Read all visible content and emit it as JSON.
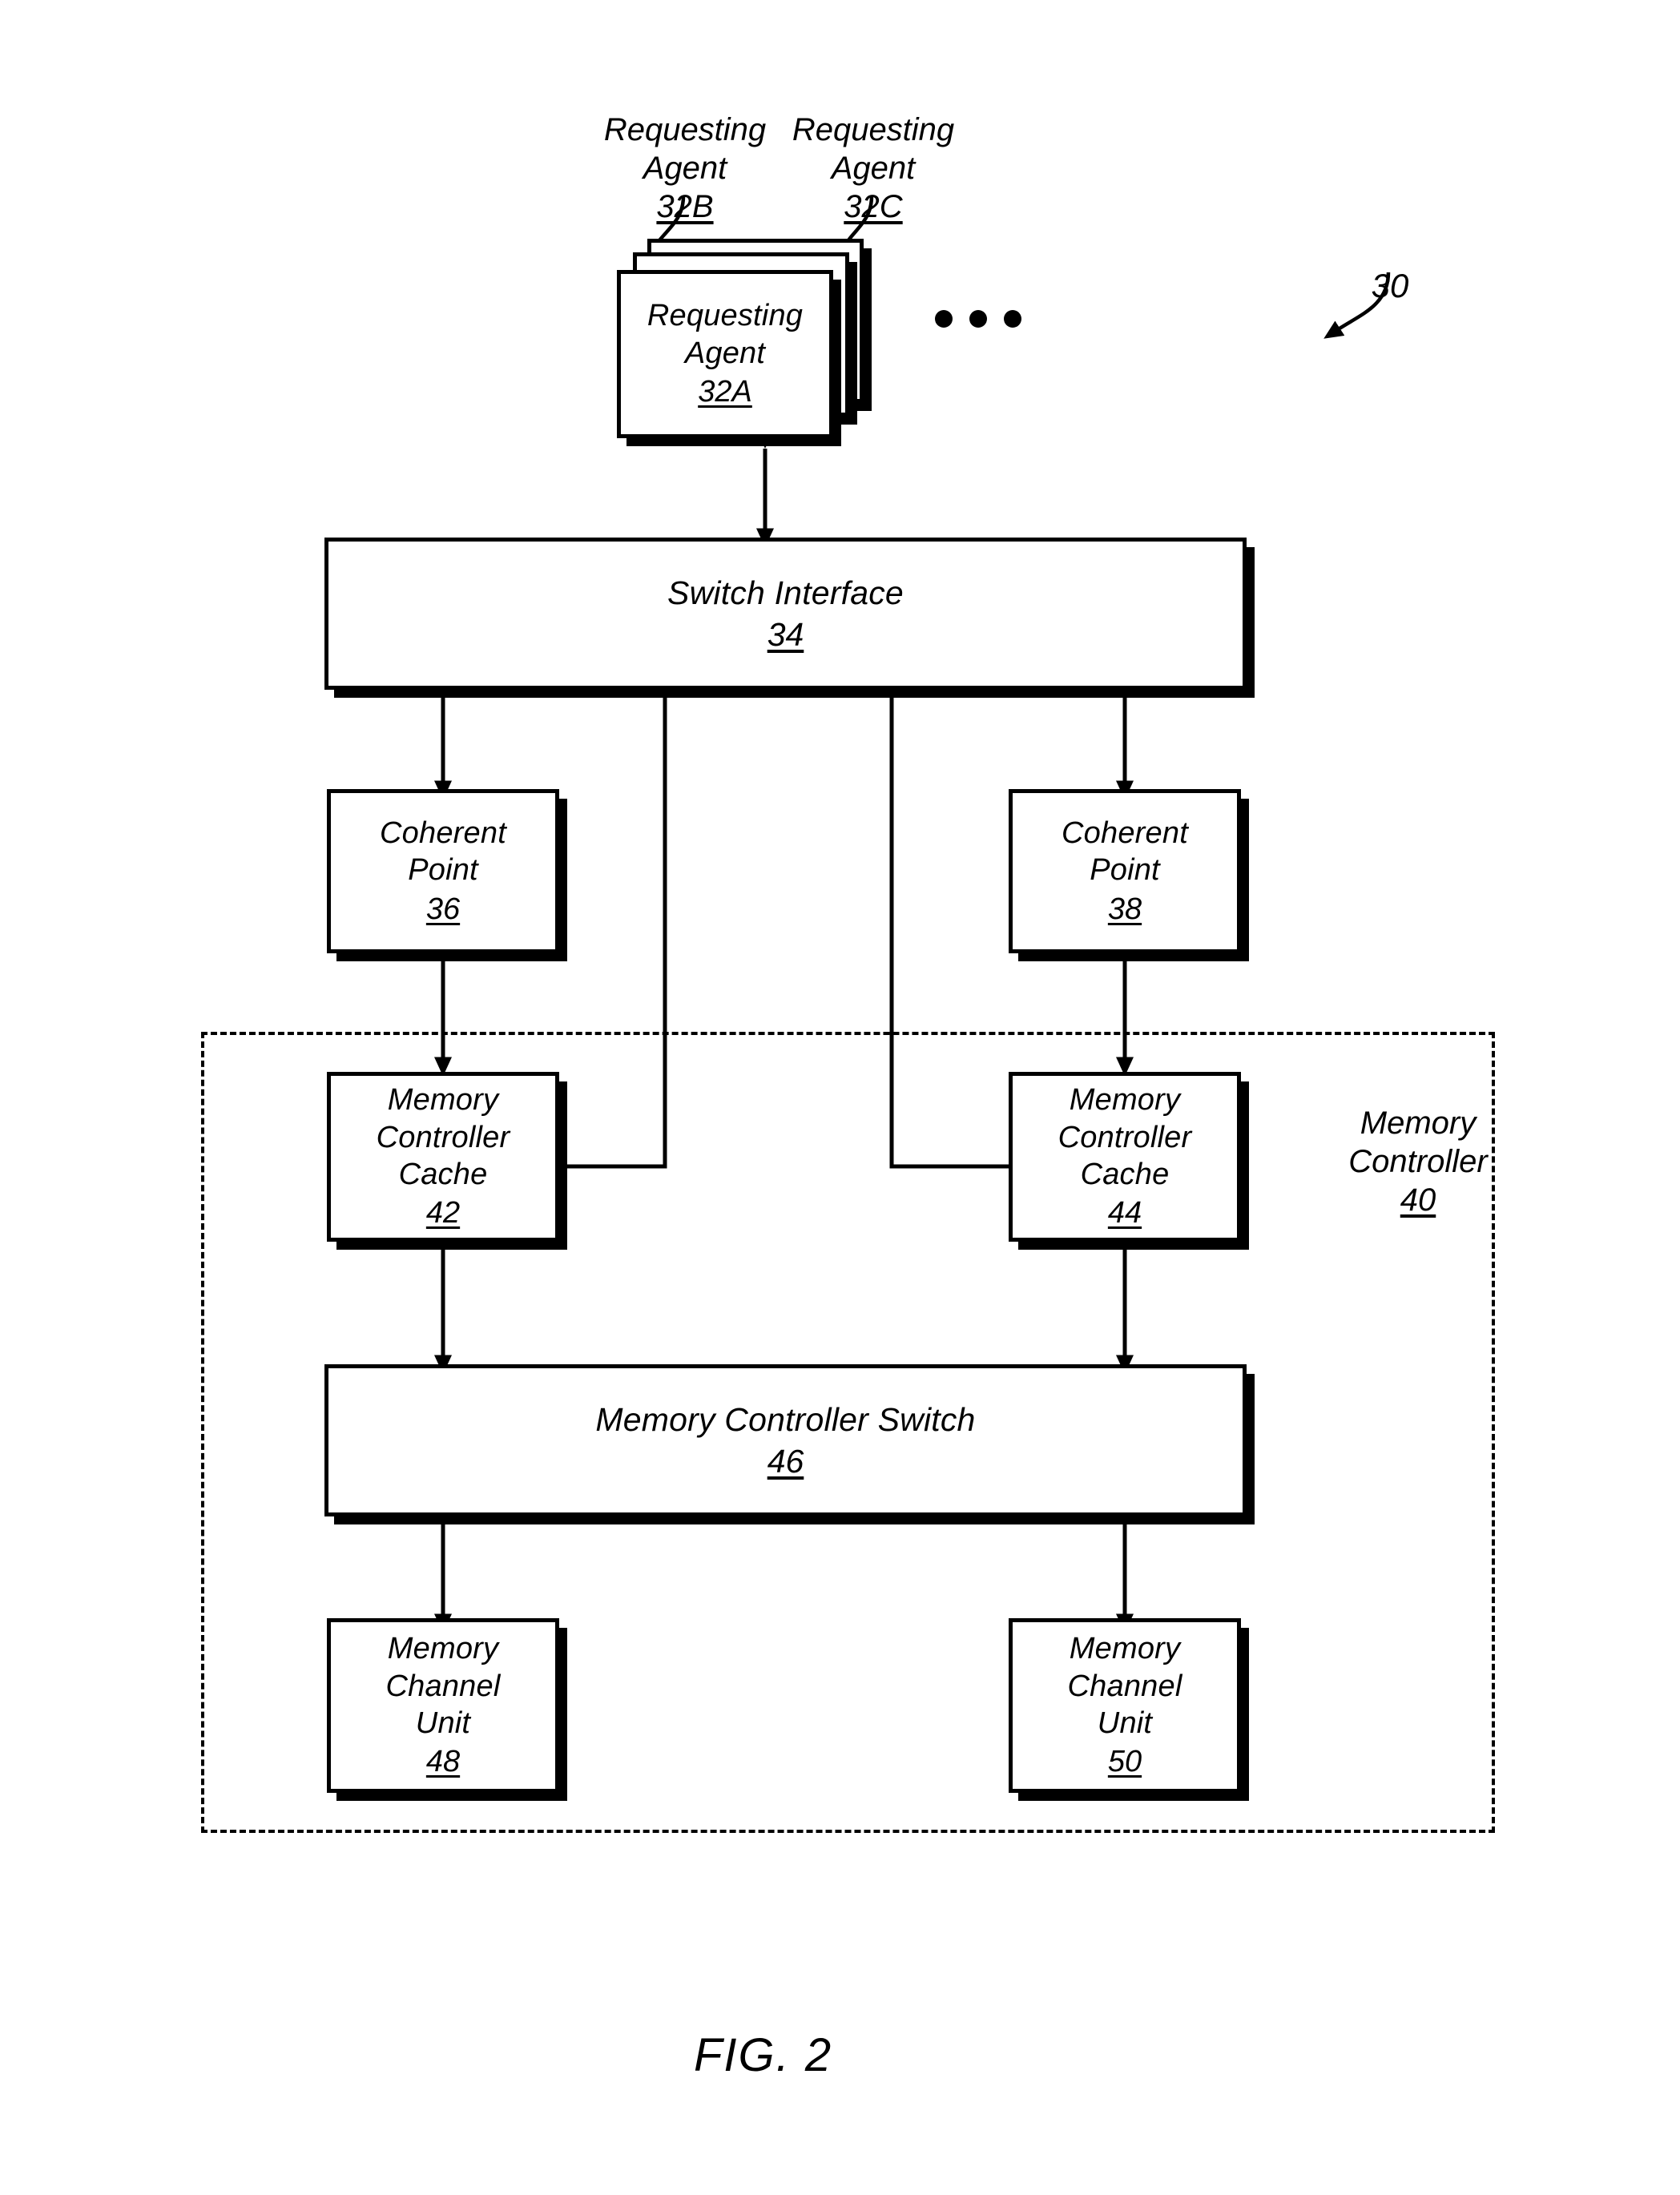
{
  "figure": {
    "caption": "FIG. 2",
    "system_ref": "30"
  },
  "labels": {
    "agent_b": {
      "title": "Requesting\nAgent",
      "ref": "32B"
    },
    "agent_c": {
      "title": "Requesting\nAgent",
      "ref": "32C"
    },
    "memory_controller_group": {
      "title": "Memory\nController",
      "ref": "40"
    }
  },
  "nodes": {
    "requesting_agent_a": {
      "title": "Requesting\nAgent",
      "ref": "32A"
    },
    "switch_interface": {
      "title": "Switch Interface",
      "ref": "34"
    },
    "coherent_point_left": {
      "title": "Coherent\nPoint",
      "ref": "36"
    },
    "coherent_point_right": {
      "title": "Coherent\nPoint",
      "ref": "38"
    },
    "memory_controller_cache_left": {
      "title": "Memory\nController\nCache",
      "ref": "42"
    },
    "memory_controller_cache_right": {
      "title": "Memory\nController\nCache",
      "ref": "44"
    },
    "memory_controller_switch": {
      "title": "Memory Controller Switch",
      "ref": "46"
    },
    "memory_channel_unit_left": {
      "title": "Memory\nChannel\nUnit",
      "ref": "48"
    },
    "memory_channel_unit_right": {
      "title": "Memory\nChannel\nUnit",
      "ref": "50"
    }
  },
  "ellipsis": {
    "symbol": "•••",
    "count": 3
  },
  "colors": {
    "ink": "#000000",
    "paper": "#ffffff"
  },
  "diagram_data": {
    "type": "block-diagram",
    "edges": [
      {
        "from": "requesting_agent_a",
        "to": "switch_interface",
        "style": "double-arrow"
      },
      {
        "from": "switch_interface",
        "to": "coherent_point_left",
        "style": "double-arrow"
      },
      {
        "from": "switch_interface",
        "to": "coherent_point_right",
        "style": "double-arrow"
      },
      {
        "from": "switch_interface",
        "to": "memory_controller_cache_left",
        "style": "single-arrow-elbow"
      },
      {
        "from": "switch_interface",
        "to": "memory_controller_cache_right",
        "style": "single-arrow-elbow"
      },
      {
        "from": "coherent_point_left",
        "to": "memory_controller_cache_left",
        "style": "double-arrow"
      },
      {
        "from": "coherent_point_right",
        "to": "memory_controller_cache_right",
        "style": "double-arrow"
      },
      {
        "from": "memory_controller_cache_left",
        "to": "memory_controller_switch",
        "style": "double-arrow"
      },
      {
        "from": "memory_controller_cache_right",
        "to": "memory_controller_switch",
        "style": "double-arrow"
      },
      {
        "from": "memory_controller_switch",
        "to": "memory_channel_unit_left",
        "style": "double-arrow"
      },
      {
        "from": "memory_controller_switch",
        "to": "memory_channel_unit_right",
        "style": "double-arrow"
      }
    ]
  }
}
